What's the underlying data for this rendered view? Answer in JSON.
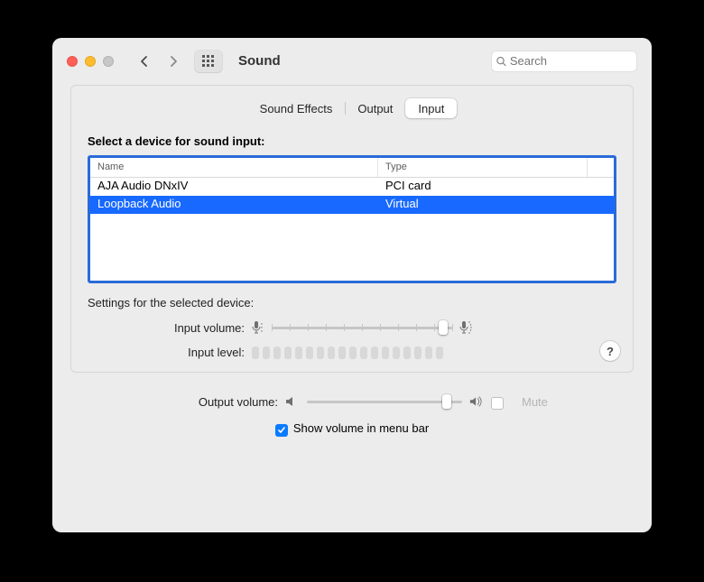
{
  "window": {
    "title": "Sound"
  },
  "search": {
    "placeholder": "Search",
    "value": ""
  },
  "tabs": {
    "sound_effects": "Sound Effects",
    "output": "Output",
    "input": "Input",
    "active": "input"
  },
  "input_panel": {
    "select_label": "Select a device for sound input:",
    "columns": {
      "name": "Name",
      "type": "Type"
    },
    "devices": [
      {
        "name": "AJA Audio DNxIV",
        "type": "PCI card",
        "selected": false
      },
      {
        "name": "Loopback Audio",
        "type": "Virtual",
        "selected": true
      }
    ],
    "settings_label": "Settings for the selected device:",
    "input_volume_label": "Input volume:",
    "input_volume_value": 0.95,
    "input_level_label": "Input level:",
    "input_level_segments": 18
  },
  "output": {
    "volume_label": "Output volume:",
    "volume_value": 0.9,
    "mute_label": "Mute",
    "mute_checked": false,
    "show_in_menubar_label": "Show volume in menu bar",
    "show_in_menubar_checked": true
  },
  "help": "?"
}
